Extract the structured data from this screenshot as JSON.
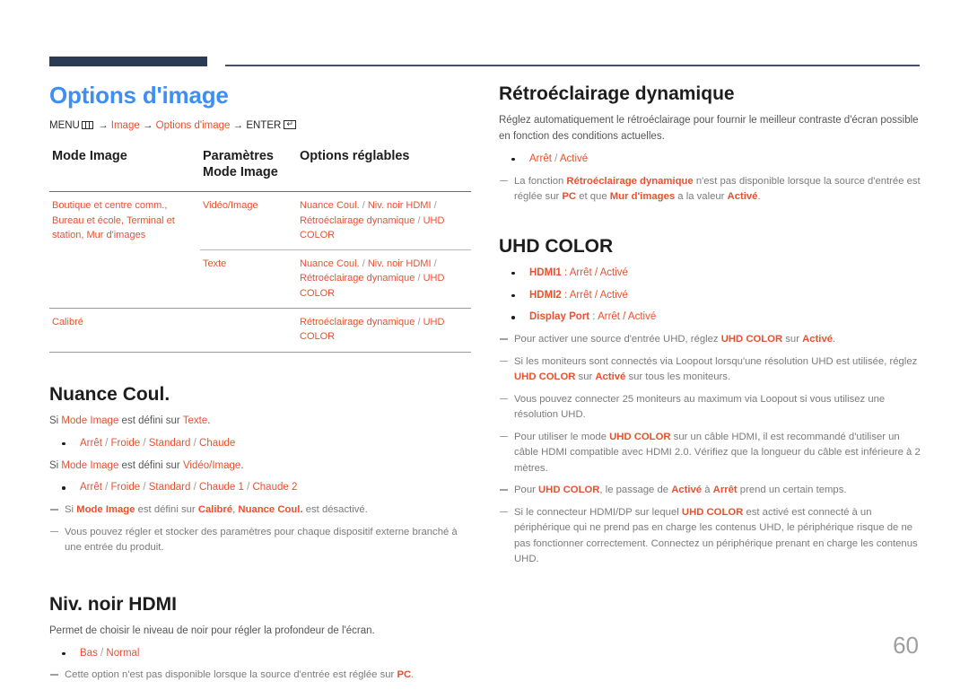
{
  "header": {
    "rule_color_thick": "#2b3a55",
    "rule_color_thin": "#4a4f68"
  },
  "page_number": "60",
  "accent_color": "#e8512f",
  "title_color": "#3d8ef5",
  "left": {
    "page_title": "Options d'image",
    "menu_path": {
      "menu_label": "MENU",
      "menu_icon": "menu-grid-icon",
      "arrow1": "→",
      "item1": "Image",
      "arrow2": "→",
      "item2": "Options d'image",
      "arrow3": "→",
      "enter_label": "ENTER",
      "enter_icon": "enter-key-icon"
    },
    "table": {
      "headers": [
        "Mode Image",
        "Paramètres Mode Image",
        "Options réglables"
      ],
      "header2_line1": "Paramètres",
      "header2_line2": "Mode Image",
      "rows": [
        {
          "mode": "Boutique et centre comm., Bureau et école, Terminal et station, Mur d'images",
          "setting": "Vidéo/Image",
          "options": "Nuance Coul. / Niv. noir HDMI / Rétroéclairage dynamique / UHD COLOR"
        },
        {
          "mode": "",
          "setting": "Texte",
          "options": "Nuance Coul. / Niv. noir HDMI / Rétroéclairage dynamique / UHD COLOR"
        },
        {
          "mode": "Calibré",
          "setting": "",
          "options": "Rétroéclairage dynamique / UHD COLOR"
        }
      ]
    },
    "nuance": {
      "title": "Nuance Coul.",
      "line1": "Si Mode Image est défini sur Texte.",
      "bullet1": "Arrêt / Froide / Standard / Chaude",
      "line2": "Si Mode Image est défini sur Vidéo/Image.",
      "bullet2": "Arrêt / Froide / Standard / Chaude 1 / Chaude 2",
      "note1": "Si Mode Image est défini sur Calibré, Nuance Coul. est désactivé.",
      "note2": "Vous pouvez régler et stocker des paramètres pour chaque dispositif externe branché à une entrée du produit."
    },
    "hdmi_black": {
      "title": "Niv. noir HDMI",
      "desc": "Permet de choisir le niveau de noir pour régler la profondeur de l'écran.",
      "bullet1": "Bas / Normal",
      "note1": "Cette option n'est pas disponible lorsque la source d'entrée est réglée sur PC."
    }
  },
  "right": {
    "backlight": {
      "title": "Rétroéclairage dynamique",
      "desc": "Réglez automatiquement le rétroéclairage pour fournir le meilleur contraste d'écran possible en fonction des conditions actuelles.",
      "bullet1": "Arrêt / Activé",
      "note1": "La fonction Rétroéclairage dynamique n'est pas disponible lorsque la source d'entrée est réglée sur PC et que Mur d'images a la valeur Activé."
    },
    "uhd_color": {
      "title": "UHD COLOR",
      "bullets": [
        {
          "label": "HDMI1",
          "value": "Arrêt / Activé"
        },
        {
          "label": "HDMI2",
          "value": "Arrêt / Activé"
        },
        {
          "label": "Display Port",
          "value": "Arrêt / Activé"
        }
      ],
      "note1": "Pour activer une source d'entrée UHD, réglez UHD COLOR sur Activé.",
      "note2": "Si les moniteurs sont connectés via Loopout lorsqu'une résolution UHD est utilisée, réglez UHD COLOR sur Activé sur tous les moniteurs.",
      "note3": "Vous pouvez connecter 25 moniteurs au maximum via Loopout si vous utilisez une résolution UHD.",
      "note4": "Pour utiliser le mode UHD COLOR sur un câble HDMI, il est recommandé d'utiliser un câble HDMI compatible avec HDMI 2.0. Vérifiez que la longueur du câble est inférieure à 2 mètres.",
      "note5": "Pour UHD COLOR, le passage de Activé à Arrêt prend un certain temps.",
      "note6": "Si le connecteur HDMI/DP sur lequel UHD COLOR est activé est connecté à un périphérique qui ne prend pas en charge les contenus UHD, le périphérique risque de ne pas fonctionner correctement. Connectez un périphérique prenant en charge les contenus UHD."
    }
  }
}
